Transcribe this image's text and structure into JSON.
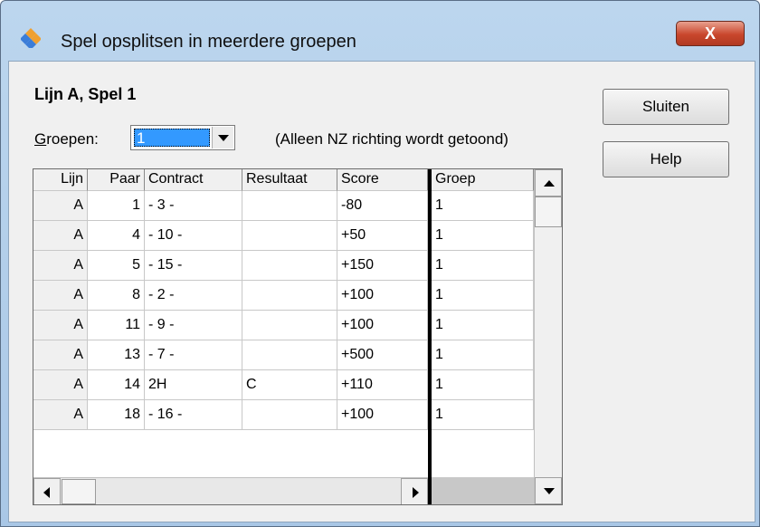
{
  "window": {
    "title": "Spel opsplitsen in meerdere groepen",
    "close_label": "X"
  },
  "heading": "Lijn A, Spel 1",
  "groepen": {
    "label_prefix": "G",
    "label_rest": "roepen:",
    "value": "1"
  },
  "note": "(Alleen NZ richting wordt getoond)",
  "buttons": {
    "close": "Sluiten",
    "help": "Help"
  },
  "table": {
    "headers": [
      "Lijn",
      "Paar",
      "Contract",
      "Resultaat",
      "Score",
      "Groep"
    ],
    "rows": [
      [
        "A",
        "1",
        "- 3 -",
        "",
        "-80",
        "1"
      ],
      [
        "A",
        "4",
        "- 10 -",
        "",
        "+50",
        "1"
      ],
      [
        "A",
        "5",
        "- 15 -",
        "",
        "+150",
        "1"
      ],
      [
        "A",
        "8",
        "- 2 -",
        "",
        "+100",
        "1"
      ],
      [
        "A",
        "11",
        "- 9 -",
        "",
        "+100",
        "1"
      ],
      [
        "A",
        "13",
        "- 7 -",
        "",
        "+500",
        "1"
      ],
      [
        "A",
        "14",
        "2H",
        "C",
        "+110",
        "1"
      ],
      [
        "A",
        "18",
        "- 16 -",
        "",
        "+100",
        "1"
      ]
    ]
  },
  "colors": {
    "selection": "#3399ff",
    "close_button": "#c9462c",
    "title_bar": "#bcd6ee"
  },
  "icons": {
    "app": "card-suits-icon"
  }
}
